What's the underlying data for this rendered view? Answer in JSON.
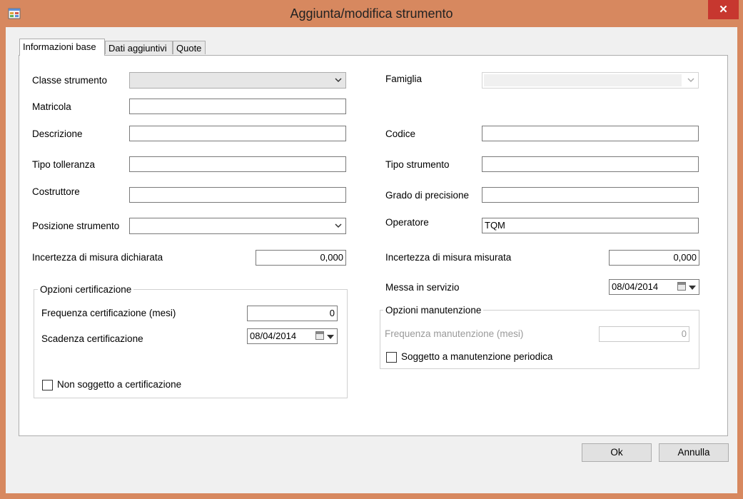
{
  "window": {
    "title": "Aggiunta/modifica strumento",
    "close_glyph": "✕",
    "icon": "app-window-icon"
  },
  "tabs": [
    {
      "label": "Informazioni base",
      "active": true
    },
    {
      "label": "Dati aggiuntivi",
      "active": false
    },
    {
      "label": "Quote",
      "active": false
    }
  ],
  "form": {
    "classe_strumento": {
      "label": "Classe strumento",
      "value": ""
    },
    "famiglia": {
      "label": "Famiglia",
      "value": ""
    },
    "matricola": {
      "label": "Matricola",
      "value": ""
    },
    "descrizione": {
      "label": "Descrizione",
      "value": ""
    },
    "codice": {
      "label": "Codice",
      "value": ""
    },
    "tipo_tolleranza": {
      "label": "Tipo tolleranza",
      "value": ""
    },
    "tipo_strumento": {
      "label": "Tipo strumento",
      "value": ""
    },
    "costruttore": {
      "label": "Costruttore",
      "value": ""
    },
    "grado_precisione": {
      "label": "Grado di precisione",
      "value": ""
    },
    "posizione_strumento": {
      "label": "Posizione strumento",
      "value": ""
    },
    "operatore": {
      "label": "Operatore",
      "value": "TQM"
    },
    "incertezza_dichiarata": {
      "label": "Incertezza di misura dichiarata",
      "value": "0,000"
    },
    "incertezza_misurata": {
      "label": "Incertezza di misura misurata",
      "value": "0,000"
    },
    "messa_in_servizio": {
      "label": "Messa in servizio",
      "value": "08/04/2014"
    }
  },
  "certificazione": {
    "title": "Opzioni certificazione",
    "frequenza_label": "Frequenza certificazione (mesi)",
    "frequenza_value": "0",
    "scadenza_label": "Scadenza certificazione",
    "scadenza_value": "08/04/2014",
    "non_soggetto_label": "Non soggetto a certificazione",
    "non_soggetto_checked": false
  },
  "manutenzione": {
    "title": "Opzioni  manutenzione",
    "frequenza_label": "Frequenza manutenzione (mesi)",
    "frequenza_value": "0",
    "soggetto_label": "Soggetto a manutenzione periodica",
    "soggetto_checked": false
  },
  "buttons": {
    "ok": "Ok",
    "annulla": "Annulla"
  },
  "colors": {
    "frame": "#d7885f",
    "close": "#c7372f",
    "client": "#f0f0f0"
  }
}
